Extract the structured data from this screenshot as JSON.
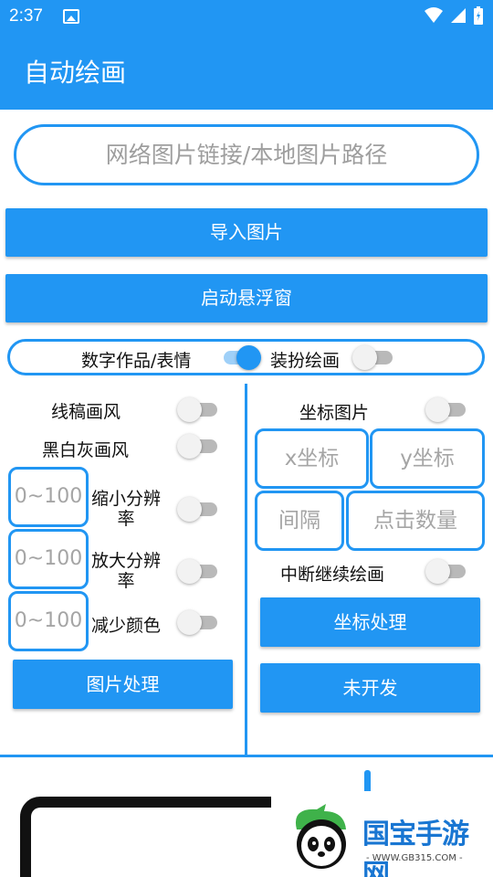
{
  "status_bar": {
    "time": "2:37"
  },
  "app_bar": {
    "title": "自动绘画"
  },
  "url_input": {
    "placeholder": "网络图片链接/本地图片路径"
  },
  "buttons": {
    "import_image": "导入图片",
    "start_float": "启动悬浮窗",
    "image_process": "图片处理",
    "coord_process": "坐标处理",
    "undeveloped": "未开发"
  },
  "mode_row": {
    "left_label": "数字作品/表情",
    "left_switch_on": true,
    "right_label": "装扮绘画",
    "right_switch_on": false
  },
  "left_options": {
    "line_style": {
      "label": "线稿画风",
      "on": false
    },
    "bw_style": {
      "label": "黑白灰画风",
      "on": false
    },
    "reduce_res": {
      "placeholder": "0~100",
      "label_line1": "缩小分辨",
      "label_line2": "率",
      "on": false
    },
    "enlarge_res": {
      "placeholder": "0~100",
      "label_line1": "放大分辨",
      "label_line2": "率",
      "on": false
    },
    "reduce_color": {
      "placeholder": "0~100",
      "label": "减少颜色",
      "on": false
    }
  },
  "right_options": {
    "coord_image": {
      "label": "坐标图片",
      "on": false
    },
    "x_coord": {
      "placeholder": "x坐标"
    },
    "y_coord": {
      "placeholder": "y坐标"
    },
    "interval": {
      "placeholder": "间隔"
    },
    "click_count": {
      "placeholder": "点击数量"
    },
    "resume_drawing": {
      "label": "中断继续绘画",
      "on": false
    }
  },
  "watermark": {
    "brand": "国宝手游网",
    "url": "- WWW.GB315.COM -"
  },
  "colors": {
    "primary": "#2196f3",
    "switch_off_track": "#b9b9b9",
    "placeholder": "#9e9e9e"
  }
}
